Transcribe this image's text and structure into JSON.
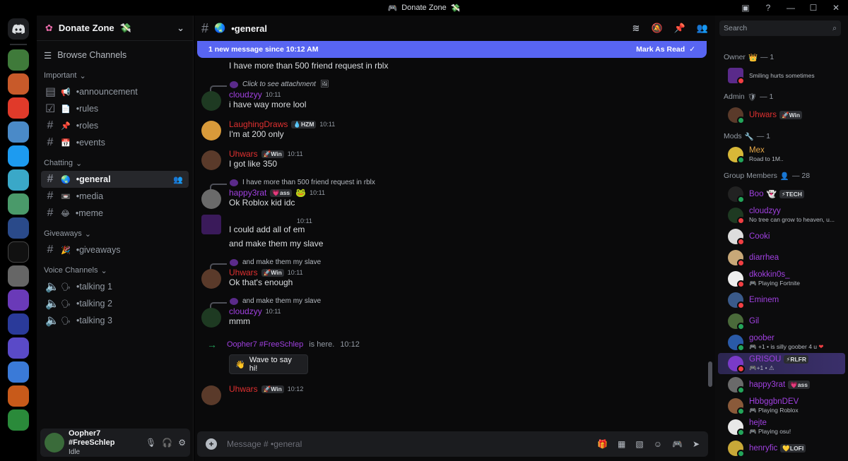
{
  "titlebar": {
    "title": "Donate Zone"
  },
  "server": {
    "name": "Donate Zone"
  },
  "sidebar": {
    "browse": "Browse Channels",
    "categories": [
      {
        "label": "Important",
        "channels": [
          "•announcement",
          "•rules",
          "•roles",
          "•events"
        ]
      },
      {
        "label": "Chatting",
        "channels": [
          "•general",
          "•media",
          "•meme"
        ]
      },
      {
        "label": "Giveaways",
        "channels": [
          "•giveaways"
        ]
      },
      {
        "label": "Voice Channels",
        "channels": [
          "•talking 1",
          "•talking 2",
          "•talking 3"
        ]
      }
    ]
  },
  "user": {
    "name": "Oopher7 #FreeSchlep",
    "status": "Idle"
  },
  "channel": {
    "name": "•general"
  },
  "banner": {
    "text": "1 new message since 10:12 AM",
    "action": "Mark As Read"
  },
  "messages": [
    {
      "text": "I have more than 500 friend request in rblx"
    },
    {
      "reply": "Click to see attachment",
      "author": "cloudzyy",
      "time": "10:11",
      "text": "i have way more lool"
    },
    {
      "author": "LaughingDraws",
      "tag": "HZM",
      "time": "10:11",
      "text": "I'm at 200 only"
    },
    {
      "author": "Uhwars",
      "tag": "Win",
      "time": "10:11",
      "text": "I got like 350"
    },
    {
      "reply": "I have more than 500 friend request in rblx",
      "author": "happy3rat",
      "tag": "ass",
      "time": "10:11",
      "text": "Ok Roblox kid idc"
    },
    {
      "time": "10:11",
      "text": "I could add all of em",
      "text2": "and make them my slave"
    },
    {
      "reply": "and make them my slave",
      "author": "Uhwars",
      "tag": "Win",
      "time": "10:11",
      "text": "Ok that's enough"
    },
    {
      "reply": "and make them my slave",
      "author": "cloudzyy",
      "time": "10:11",
      "text": "mmm"
    },
    {
      "join_name": "Oopher7 #FreeSchlep",
      "join_text": "is here.",
      "time": "10:12",
      "wave": "Wave to say hi!"
    },
    {
      "author": "Uhwars",
      "tag": "Win",
      "time": "10:12"
    }
  ],
  "composer": {
    "placeholder": "Message # •general"
  },
  "member_search": {
    "placeholder": "Search"
  },
  "member_groups": [
    {
      "label": "Owner",
      "count": "— 1",
      "members": [
        {
          "name": "",
          "status": "Smiling hurts sometimes"
        }
      ]
    },
    {
      "label": "Admin",
      "count": "— 1",
      "members": [
        {
          "name": "Uhwars",
          "tag": "Win"
        }
      ]
    },
    {
      "label": "Mods",
      "count": "— 1",
      "members": [
        {
          "name": "Mex",
          "status": "Road to 1M.."
        }
      ]
    },
    {
      "label": "Group Members",
      "count": "— 28",
      "members": [
        {
          "name": "Boo",
          "tag": "TECH"
        },
        {
          "name": "cloudzyy",
          "status": "No tree can grow to heaven, u..."
        },
        {
          "name": "Cooki"
        },
        {
          "name": "diarrhea"
        },
        {
          "name": "dkokkin0s_",
          "status": "Playing Fortnite"
        },
        {
          "name": "Eminem"
        },
        {
          "name": "Gil"
        },
        {
          "name": "goober",
          "status": "+1 • is silly goober 4 u"
        },
        {
          "name": "GRISOU",
          "tag": "RLFR",
          "status": "+1 •"
        },
        {
          "name": "happy3rat",
          "tag": "ass"
        },
        {
          "name": "HbbggbnDEV",
          "status": "Playing Roblox"
        },
        {
          "name": "hejte",
          "status": "Playing osu!"
        },
        {
          "name": "henryfic",
          "tag": "LOFI"
        }
      ]
    }
  ],
  "colors": {
    "accent": "#5865f2",
    "uhwars": "#e03030",
    "purple": "#a040e0",
    "mex": "#e8a848",
    "online": "#23a55a",
    "dnd": "#f23f43"
  }
}
